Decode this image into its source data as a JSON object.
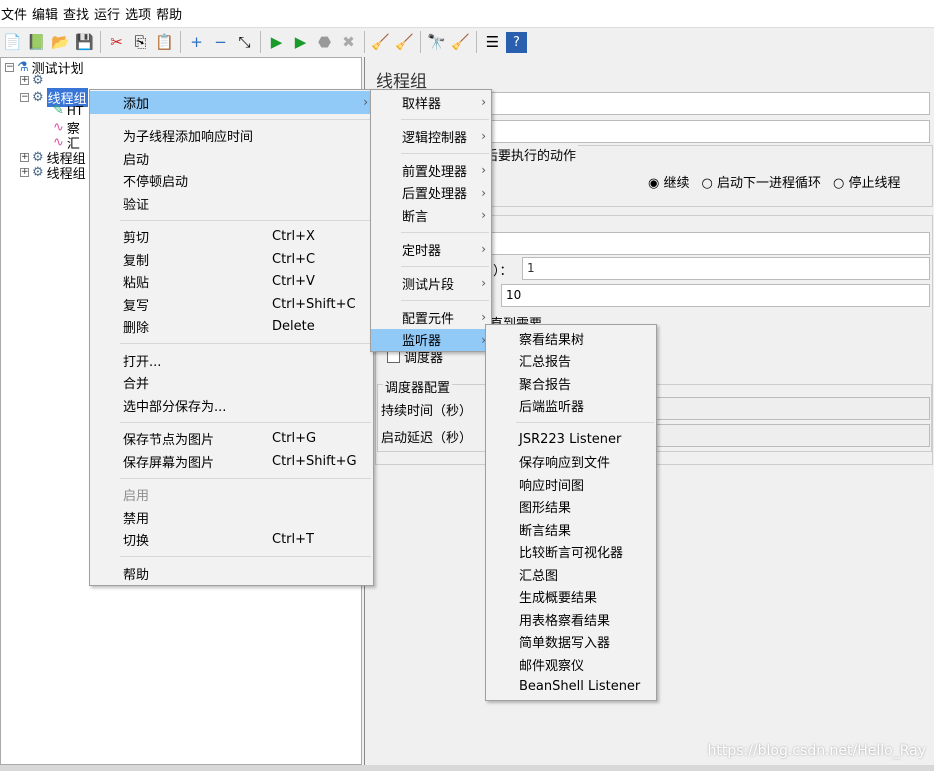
{
  "menubar": [
    "文件",
    "编辑",
    "查找",
    "运行",
    "选项",
    "帮助"
  ],
  "toolbar": {
    "icons": [
      "new-icon",
      "templates-icon",
      "open-icon",
      "save-icon",
      "cut-icon",
      "copy-icon",
      "paste-icon",
      "expand-icon",
      "collapse-icon",
      "toggle-icon",
      "start-icon",
      "start-no-pause-icon",
      "stop-icon",
      "shutdown-icon",
      "clear-icon",
      "clear-all-icon",
      "search-icon",
      "reset-search-icon",
      "function-helper-icon",
      "help-icon"
    ]
  },
  "tree": {
    "root": "测试计划",
    "nodes": [
      "线程组",
      "HT",
      "察",
      "汇",
      "线程组",
      "线程组"
    ]
  },
  "right": {
    "title": "线程组",
    "error_action_label": "在取样器错误后要执行的动作",
    "radios": [
      {
        "label": "继续",
        "checked": true
      },
      {
        "label": "启动下一进程循环",
        "checked": false
      },
      {
        "label": "停止线程",
        "checked": false
      }
    ],
    "ramp_label_tail": "）：",
    "ramp_value": "1",
    "loop_value": "10",
    "delay_tail": "直到需要",
    "scheduler_label": "调度器",
    "scheduler_config": "调度器配置",
    "duration_label": "持续时间（秒）",
    "startup_delay_label": "启动延迟（秒）"
  },
  "context_menu": {
    "items": [
      {
        "label": "添加",
        "submenu": true,
        "highlighted": true
      },
      {
        "sep": true
      },
      {
        "label": "为子线程添加响应时间"
      },
      {
        "label": "启动"
      },
      {
        "label": "不停顿启动"
      },
      {
        "label": "验证"
      },
      {
        "sep": true
      },
      {
        "label": "剪切",
        "shortcut": "Ctrl+X"
      },
      {
        "label": "复制",
        "shortcut": "Ctrl+C"
      },
      {
        "label": "粘贴",
        "shortcut": "Ctrl+V"
      },
      {
        "label": "复写",
        "shortcut": "Ctrl+Shift+C"
      },
      {
        "label": "删除",
        "shortcut": "Delete"
      },
      {
        "sep": true
      },
      {
        "label": "打开..."
      },
      {
        "label": "合并"
      },
      {
        "label": "选中部分保存为..."
      },
      {
        "sep": true
      },
      {
        "label": "保存节点为图片",
        "shortcut": "Ctrl+G"
      },
      {
        "label": "保存屏幕为图片",
        "shortcut": "Ctrl+Shift+G"
      },
      {
        "sep": true
      },
      {
        "label": "启用",
        "disabled": true
      },
      {
        "label": "禁用"
      },
      {
        "label": "切换",
        "shortcut": "Ctrl+T"
      },
      {
        "sep": true
      },
      {
        "label": "帮助"
      }
    ]
  },
  "add_submenu": {
    "items": [
      {
        "label": "取样器"
      },
      {
        "sep": true
      },
      {
        "label": "逻辑控制器"
      },
      {
        "sep": true
      },
      {
        "label": "前置处理器"
      },
      {
        "label": "后置处理器"
      },
      {
        "label": "断言"
      },
      {
        "sep": true
      },
      {
        "label": "定时器"
      },
      {
        "sep": true
      },
      {
        "label": "测试片段"
      },
      {
        "sep": true
      },
      {
        "label": "配置元件"
      },
      {
        "label": "监听器",
        "highlighted": true
      }
    ]
  },
  "listener_submenu": {
    "items": [
      {
        "label": "察看结果树"
      },
      {
        "label": "汇总报告"
      },
      {
        "label": "聚合报告"
      },
      {
        "label": "后端监听器"
      },
      {
        "sep": true
      },
      {
        "label": "JSR223 Listener"
      },
      {
        "label": "保存响应到文件"
      },
      {
        "label": "响应时间图"
      },
      {
        "label": "图形结果"
      },
      {
        "label": "断言结果"
      },
      {
        "label": "比较断言可视化器"
      },
      {
        "label": "汇总图"
      },
      {
        "label": "生成概要结果"
      },
      {
        "label": "用表格察看结果"
      },
      {
        "label": "简单数据写入器"
      },
      {
        "label": "邮件观察仪"
      },
      {
        "label": "BeanShell Listener"
      }
    ]
  },
  "watermark": "https://blog.csdn.net/Hello_Ray",
  "colors": {
    "highlight": "#91c9f7",
    "selection": "#3875d7"
  }
}
